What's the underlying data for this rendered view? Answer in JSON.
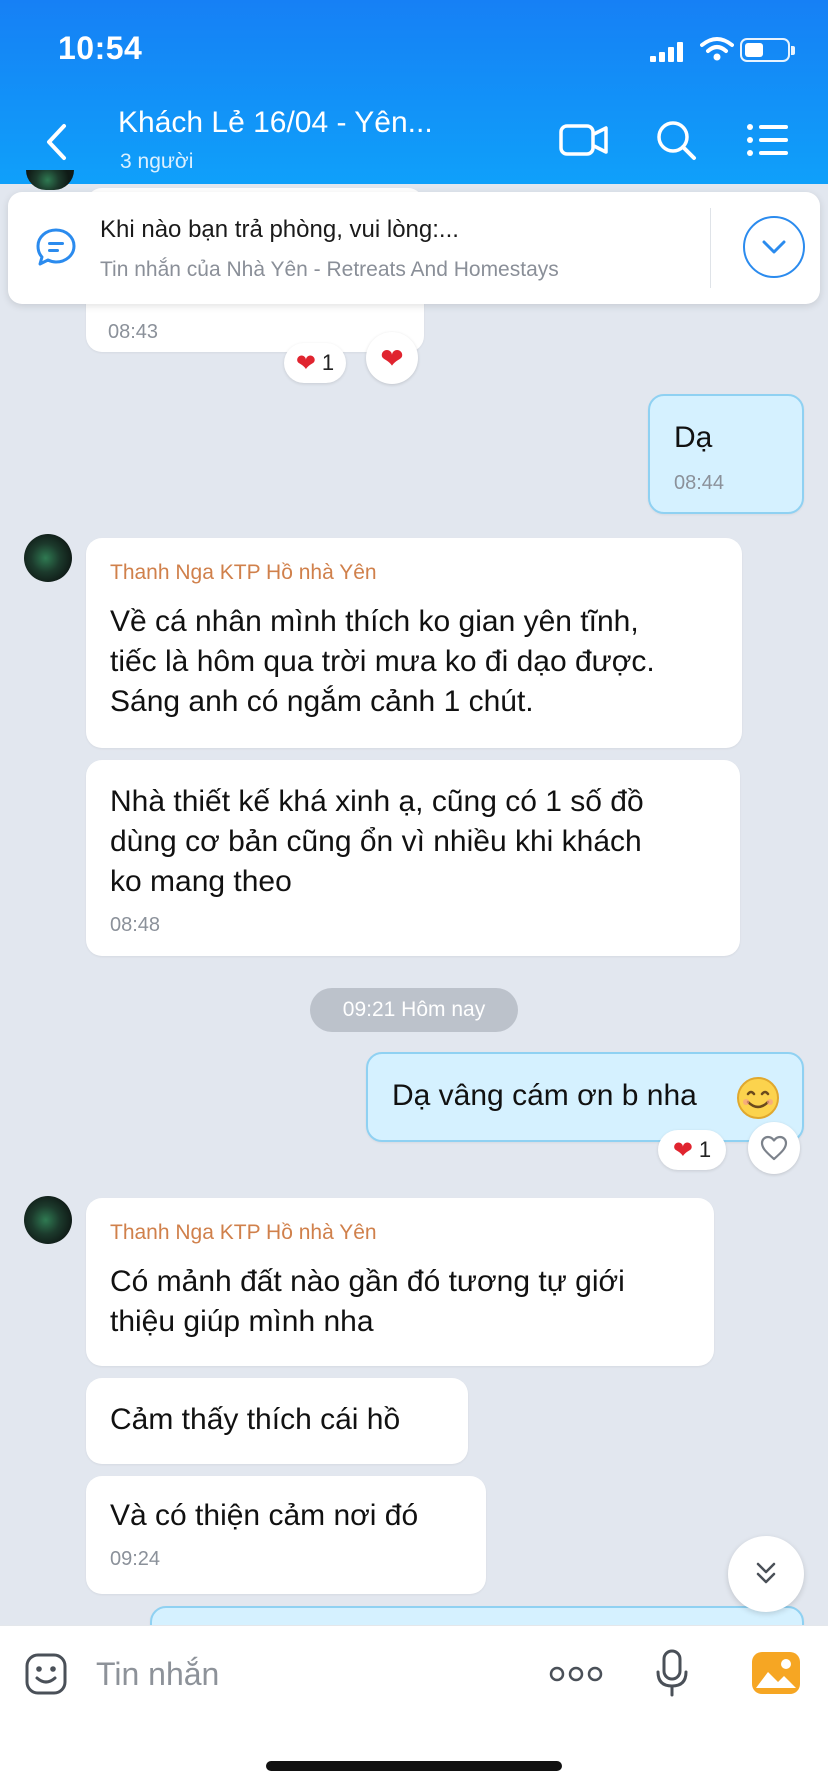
{
  "status_bar": {
    "time": "10:54"
  },
  "header": {
    "title": "Khách Lẻ 16/04 - Yên...",
    "subtitle": "3 người",
    "icons": [
      "back-icon",
      "video-call-icon",
      "search-icon",
      "menu-icon"
    ]
  },
  "pinned": {
    "text": "Khi nào bạn trả phòng, vui lòng:...",
    "sub": "Tin nhắn của Nhà Yên - Retreats And Homestays"
  },
  "messages": {
    "m0": {
      "time": "08:43",
      "reaction_count": "1"
    },
    "m1": {
      "text": "Dạ",
      "time": "08:44"
    },
    "m2": {
      "sender": "Thanh Nga KTP Hồ nhà Yên",
      "lines": [
        "Về cá nhân mình thích ko gian yên tĩnh,",
        "tiếc là hôm qua trời mưa ko đi dạo được.",
        "Sáng anh có ngắm cảnh 1 chút."
      ]
    },
    "m3": {
      "lines": [
        "Nhà thiết kế khá xinh ạ, cũng có 1 số đồ",
        "dùng cơ bản cũng ổn vì nhiều khi khách",
        "ko mang theo"
      ],
      "time": "08:48"
    },
    "date_divider": "09:21 Hôm nay",
    "m4": {
      "text": "Dạ vâng cám ơn b nha",
      "reaction_count": "1"
    },
    "m5": {
      "sender": "Thanh Nga KTP Hồ nhà Yên",
      "lines": [
        "Có mảnh đất nào gần đó tương tự giới",
        "thiệu giúp mình nha"
      ]
    },
    "m6": {
      "text": "Cảm thấy thích cái hồ"
    },
    "m7": {
      "text": "Và có thiện cảm nơi đó",
      "time": "09:24"
    }
  },
  "input": {
    "placeholder": "Tin nhắn",
    "icons": [
      "emoji-icon",
      "more-icon",
      "mic-icon",
      "gallery-icon"
    ]
  },
  "colors": {
    "header": "#1680f5",
    "background": "#e2e7ef",
    "my_bubble": "#d5f1ff",
    "sender_name": "#d0804b",
    "accent": "#2b8bee",
    "heart": "#e0242f"
  }
}
